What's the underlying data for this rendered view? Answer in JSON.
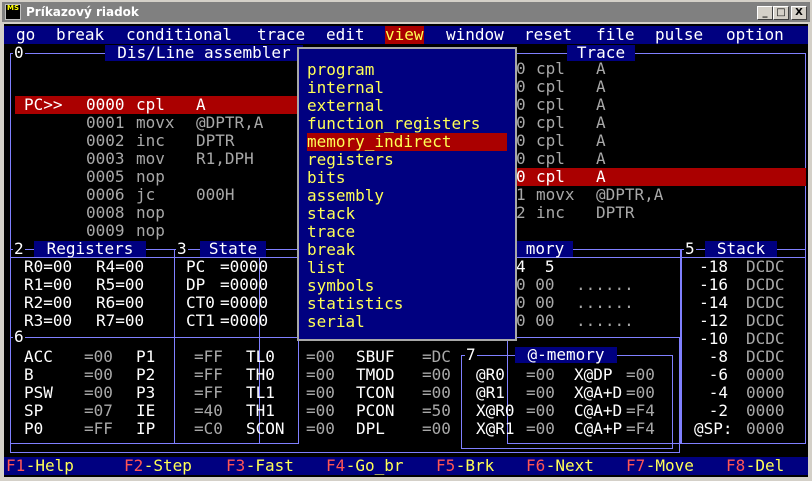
{
  "window": {
    "title": "Príkazový riadok",
    "icon_text": "MS",
    "minimize": "_",
    "maximize": "□",
    "close": "X"
  },
  "menubar": [
    "go",
    "break",
    "conditional",
    "trace",
    "edit",
    "view",
    "window",
    "reset",
    "file",
    "pulse",
    "option"
  ],
  "view_menu": {
    "items": [
      "program",
      "internal",
      "external",
      "function_registers",
      "memory_indirect",
      "registers",
      "bits",
      "assembly",
      "stack",
      "trace",
      "break",
      "list",
      "symbols",
      "statistics",
      "serial"
    ],
    "selected": "memory_indirect"
  },
  "disasm": {
    "number": "0",
    "title": "Dis/Line assembler",
    "pc_marker": "PC>>",
    "lines": [
      {
        "addr": "0000",
        "op": "cpl",
        "arg": "A"
      },
      {
        "addr": "0001",
        "op": "movx",
        "arg": "@DPTR,A"
      },
      {
        "addr": "0002",
        "op": "inc",
        "arg": "DPTR"
      },
      {
        "addr": "0003",
        "op": "mov",
        "arg": "R1,DPH"
      },
      {
        "addr": "0005",
        "op": "nop",
        "arg": ""
      },
      {
        "addr": "0006",
        "op": "jc",
        "arg": "000H"
      },
      {
        "addr": "0008",
        "op": "nop",
        "arg": ""
      },
      {
        "addr": "0009",
        "op": "nop",
        "arg": ""
      }
    ]
  },
  "trace": {
    "title": "Trace",
    "lines": [
      {
        "n": "0",
        "op": "cpl",
        "arg": "A"
      },
      {
        "n": "0",
        "op": "cpl",
        "arg": "A"
      },
      {
        "n": "0",
        "op": "cpl",
        "arg": "A"
      },
      {
        "n": "0",
        "op": "cpl",
        "arg": "A"
      },
      {
        "n": "0",
        "op": "cpl",
        "arg": "A"
      },
      {
        "n": "0",
        "op": "cpl",
        "arg": "A"
      },
      {
        "n": "0",
        "op": "cpl",
        "arg": "A"
      },
      {
        "n": "1",
        "op": "movx",
        "arg": "@DPTR,A"
      },
      {
        "n": "2",
        "op": "inc",
        "arg": "DPTR"
      }
    ]
  },
  "registers": {
    "number": "2",
    "title": "Registers",
    "rows": [
      [
        "R0=00",
        "R4=00"
      ],
      [
        "R1=00",
        "R5=00"
      ],
      [
        "R2=00",
        "R6=00"
      ],
      [
        "R3=00",
        "R7=00"
      ]
    ]
  },
  "state": {
    "number": "3",
    "title": "State",
    "rows": [
      [
        "PC",
        "=0000"
      ],
      [
        "DP",
        "=0000"
      ],
      [
        "CT0",
        "=0000"
      ],
      [
        "CT1",
        "=0000"
      ]
    ]
  },
  "memory": {
    "title_fragment": "mory",
    "header": "4  5",
    "rows": [
      [
        "0 00",
        "......"
      ],
      [
        "0 00",
        "......"
      ],
      [
        "0 00",
        "......"
      ]
    ]
  },
  "stack": {
    "number": "5",
    "title": "Stack",
    "rows": [
      [
        "-18",
        "DCDC"
      ],
      [
        "-16",
        "DCDC"
      ],
      [
        "-14",
        "DCDC"
      ],
      [
        "-12",
        "DCDC"
      ],
      [
        "-10",
        "DCDC"
      ],
      [
        "-8",
        "DCDC"
      ],
      [
        "-6",
        "0000"
      ],
      [
        "-4",
        "0000"
      ],
      [
        "-2",
        "0000"
      ],
      [
        "@SP:",
        "0000"
      ]
    ]
  },
  "sfr": {
    "number": "6",
    "rows": [
      [
        "ACC",
        "=00",
        "P1",
        "=FF",
        "TL0",
        "=00",
        "SBUF",
        "=DC"
      ],
      [
        "B",
        "=00",
        "P2",
        "=FF",
        "TH0",
        "=00",
        "TMOD",
        "=00"
      ],
      [
        "PSW",
        "=00",
        "P3",
        "=FF",
        "TL1",
        "=00",
        "TCON",
        "=00"
      ],
      [
        "SP",
        "=07",
        "IE",
        "=40",
        "TH1",
        "=00",
        "PCON",
        "=50"
      ],
      [
        "P0",
        "=FF",
        "IP",
        "=C0",
        "SCON",
        "=00",
        "DPL",
        "=00"
      ]
    ]
  },
  "atmem": {
    "number": "7",
    "title": "@-memory",
    "rows": [
      [
        "@R0",
        "=00",
        "X@DP",
        "=00"
      ],
      [
        "@R1",
        "=00",
        "X@A+D",
        "=00"
      ],
      [
        "X@R0",
        "=00",
        "C@A+D",
        "=F4"
      ],
      [
        "X@R1",
        "=00",
        "C@A+P",
        "=F4"
      ]
    ]
  },
  "fkeys": [
    {
      "k": "F1",
      "l": "-Help"
    },
    {
      "k": "F2",
      "l": "-Step"
    },
    {
      "k": "F3",
      "l": "-Fast"
    },
    {
      "k": "F4",
      "l": "-Go_br"
    },
    {
      "k": "F5",
      "l": "-Brk"
    },
    {
      "k": "F6",
      "l": "-Next"
    },
    {
      "k": "F7",
      "l": "-Move"
    },
    {
      "k": "F8",
      "l": "-Del"
    }
  ],
  "colors": {
    "menubar_bg": "#000080",
    "highlight": "#aa0000",
    "accent": "#ffff55",
    "frame": "#8080ff"
  }
}
